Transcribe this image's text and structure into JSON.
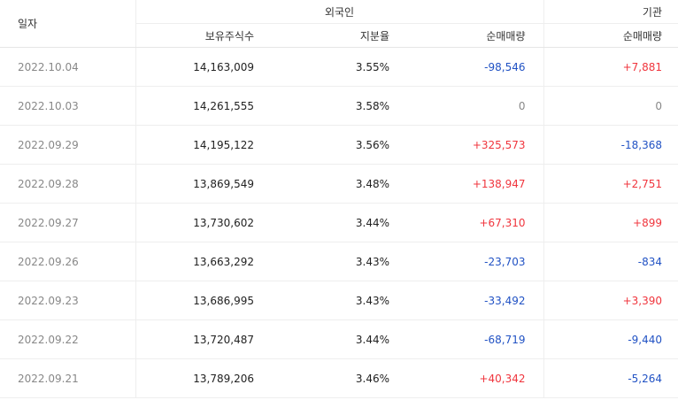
{
  "headers": {
    "date": "일자",
    "foreign_group": "외국인",
    "institution_group": "기관",
    "holdings": "보유주식수",
    "ratio": "지분율",
    "foreign_net": "순매매량",
    "institution_net": "순매매량"
  },
  "rows": [
    {
      "date": "2022.10.04",
      "holdings": "14,163,009",
      "ratio": "3.55%",
      "foreign_net": "-98,546",
      "institution_net": "+7,881"
    },
    {
      "date": "2022.10.03",
      "holdings": "14,261,555",
      "ratio": "3.58%",
      "foreign_net": "0",
      "institution_net": "0"
    },
    {
      "date": "2022.09.29",
      "holdings": "14,195,122",
      "ratio": "3.56%",
      "foreign_net": "+325,573",
      "institution_net": "-18,368"
    },
    {
      "date": "2022.09.28",
      "holdings": "13,869,549",
      "ratio": "3.48%",
      "foreign_net": "+138,947",
      "institution_net": "+2,751"
    },
    {
      "date": "2022.09.27",
      "holdings": "13,730,602",
      "ratio": "3.44%",
      "foreign_net": "+67,310",
      "institution_net": "+899"
    },
    {
      "date": "2022.09.26",
      "holdings": "13,663,292",
      "ratio": "3.43%",
      "foreign_net": "-23,703",
      "institution_net": "-834"
    },
    {
      "date": "2022.09.23",
      "holdings": "13,686,995",
      "ratio": "3.43%",
      "foreign_net": "-33,492",
      "institution_net": "+3,390"
    },
    {
      "date": "2022.09.22",
      "holdings": "13,720,487",
      "ratio": "3.44%",
      "foreign_net": "-68,719",
      "institution_net": "-9,440"
    },
    {
      "date": "2022.09.21",
      "holdings": "13,789,206",
      "ratio": "3.46%",
      "foreign_net": "+40,342",
      "institution_net": "-5,264"
    }
  ],
  "colors": {
    "positive": "#f0353d",
    "negative": "#2152c4",
    "neutral": "#888888"
  }
}
